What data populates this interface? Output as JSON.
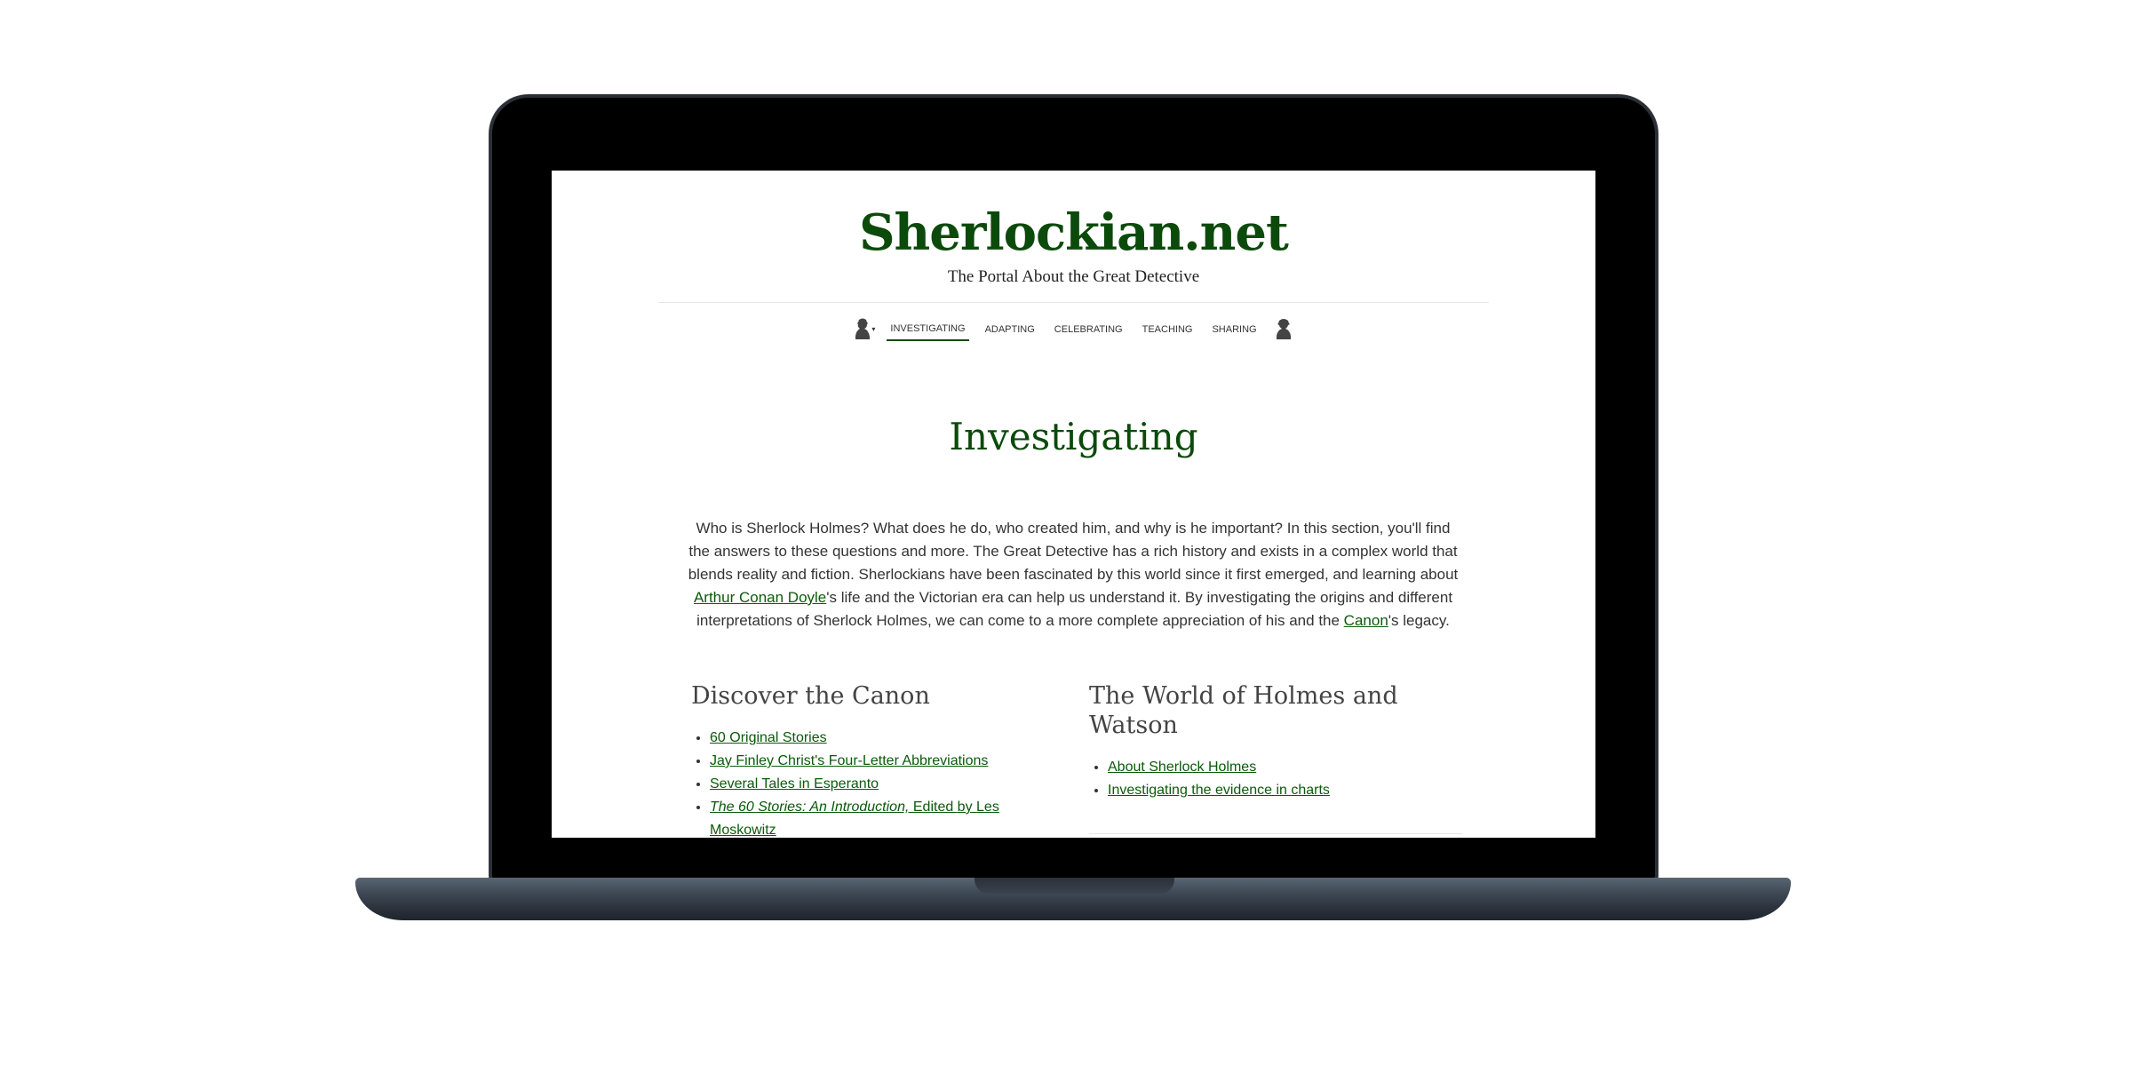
{
  "site": {
    "title": "Sherlockian.net",
    "tagline": "The Portal About the Great Detective"
  },
  "nav": {
    "left_icon": "holmes-silhouette-icon",
    "right_icon": "holmes-silhouette-icon",
    "items": [
      {
        "label": "INVESTIGATING",
        "active": true
      },
      {
        "label": "ADAPTING",
        "active": false
      },
      {
        "label": "CELEBRATING",
        "active": false
      },
      {
        "label": "TEACHING",
        "active": false
      },
      {
        "label": "SHARING",
        "active": false
      }
    ]
  },
  "page": {
    "title": "Investigating",
    "intro_1": "Who is Sherlock Holmes? What does he do, who created him, and why is he important? In this section, you'll find the answers to these questions and more. The Great Detective has a rich history and exists in a complex world that blends reality and fiction. Sherlockians have been fascinated by this world since it first emerged, and learning about ",
    "intro_link_doyle": "Arthur Conan Doyle",
    "intro_2": "'s life and the Victorian era can help us understand it. By investigating the origins and different interpretations of Sherlock Holmes, we can come to a more complete appreciation of his and the ",
    "intro_link_canon": "Canon",
    "intro_3": "'s legacy."
  },
  "discover": {
    "heading": "Discover the Canon",
    "links": [
      "60 Original Stories",
      "Jay Finley Christ's Four-Letter Abbreviations",
      "Several Tales in Esperanto"
    ],
    "last_italic": "The 60 Stories: An Introduction,",
    "last_rest": " Edited by Les Moskowitz"
  },
  "world": {
    "heading": "The World of Holmes and Watson",
    "links": [
      "About Sherlock Holmes",
      "Investigating the evidence in charts"
    ]
  },
  "colors": {
    "accent": "#0b4a0b",
    "link": "#0b5a0b"
  }
}
